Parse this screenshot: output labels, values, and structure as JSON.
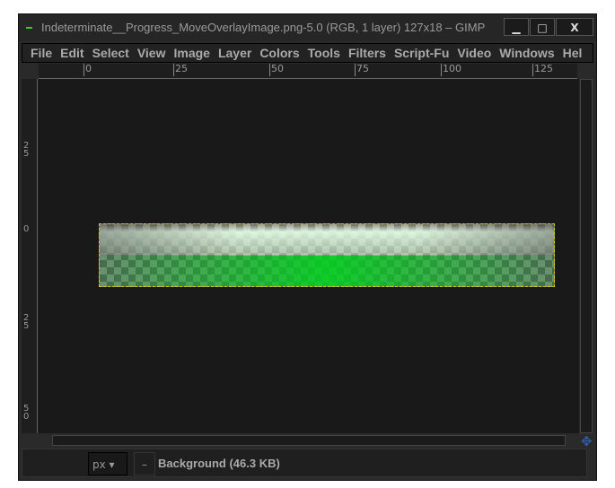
{
  "window": {
    "title": "Indeterminate__Progress_MoveOverlayImage.png-5.0 (RGB, 1 layer) 127x18 – GIMP",
    "minimize": "▁",
    "maximize": "□",
    "close": "X"
  },
  "menu": [
    "File",
    "Edit",
    "Select",
    "View",
    "Image",
    "Layer",
    "Colors",
    "Tools",
    "Filters",
    "Script-Fu",
    "Video",
    "Windows",
    "Hel"
  ],
  "hruler": [
    "0",
    "25",
    "50",
    "75",
    "100",
    "125"
  ],
  "vruler": [
    "25",
    "0",
    "25",
    "50"
  ],
  "status": {
    "unit": "px",
    "zoom": "–",
    "layer_info": "Background (46.3 KB)"
  },
  "colors": {
    "selection": "#cccc00",
    "progress_green": "#00d21e",
    "nav_icon": "#2d5fa8"
  }
}
